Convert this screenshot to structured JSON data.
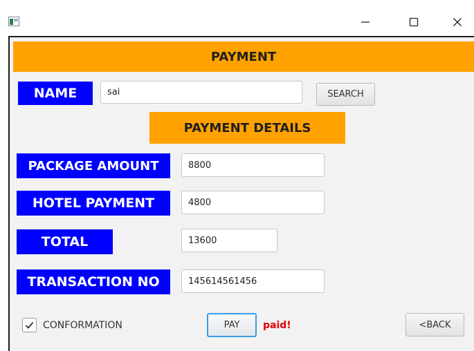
{
  "window": {
    "icons": {
      "app": "app-icon",
      "minimize": "minimize-icon",
      "maximize": "maximize-icon",
      "close": "close-icon"
    }
  },
  "header": {
    "title": "PAYMENT"
  },
  "name_row": {
    "label": "NAME",
    "value": "sai",
    "search_label": "SEARCH"
  },
  "details": {
    "title": "PAYMENT DETAILS",
    "package_amount": {
      "label": "PACKAGE AMOUNT",
      "value": "8800"
    },
    "hotel_payment": {
      "label": "HOTEL PAYMENT",
      "value": "4800"
    },
    "total": {
      "label": "TOTAL",
      "value": "13600"
    },
    "transaction_no": {
      "label": "TRANSACTION NO",
      "value": "145614561456"
    }
  },
  "footer": {
    "confirmation_label": "CONFORMATION",
    "confirmation_checked": true,
    "pay_label": "PAY",
    "status_text": "paid!",
    "back_label": "<BACK"
  },
  "colors": {
    "banner": "#ffa200",
    "label_bg": "#0000ff",
    "status": "#e00000",
    "focus": "#3a9ce8"
  }
}
